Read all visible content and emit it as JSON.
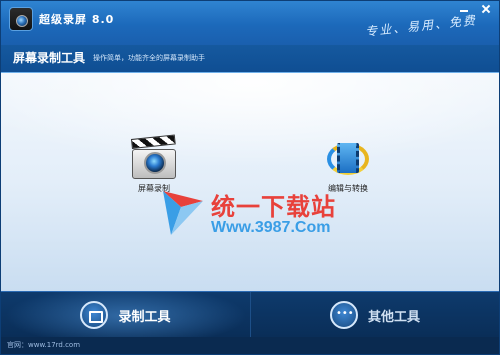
{
  "window": {
    "app_title": "超级录屏 8.0",
    "slogan": "专业、易用、免费"
  },
  "section": {
    "title": "屏幕录制工具",
    "subtitle": "操作简单，功能齐全的屏幕录制助手"
  },
  "tools": [
    {
      "label": "屏幕录制",
      "icon": "clapperboard-icon"
    },
    {
      "label": "编辑与转换",
      "icon": "film-reel-icon"
    }
  ],
  "watermark": {
    "title": "统一下载站",
    "url": "Www.3987.Com"
  },
  "bottom_tabs": [
    {
      "label": "录制工具",
      "icon": "record-icon",
      "active": true
    },
    {
      "label": "其他工具",
      "icon": "more-dots-icon",
      "active": false
    }
  ],
  "status": {
    "text": "官网：www.17rd.com"
  },
  "colors": {
    "titlebar": "#1c69ba",
    "bottombar": "#0a2e58",
    "watermark_red": "#e8413b",
    "watermark_blue": "#3a9ee6"
  }
}
